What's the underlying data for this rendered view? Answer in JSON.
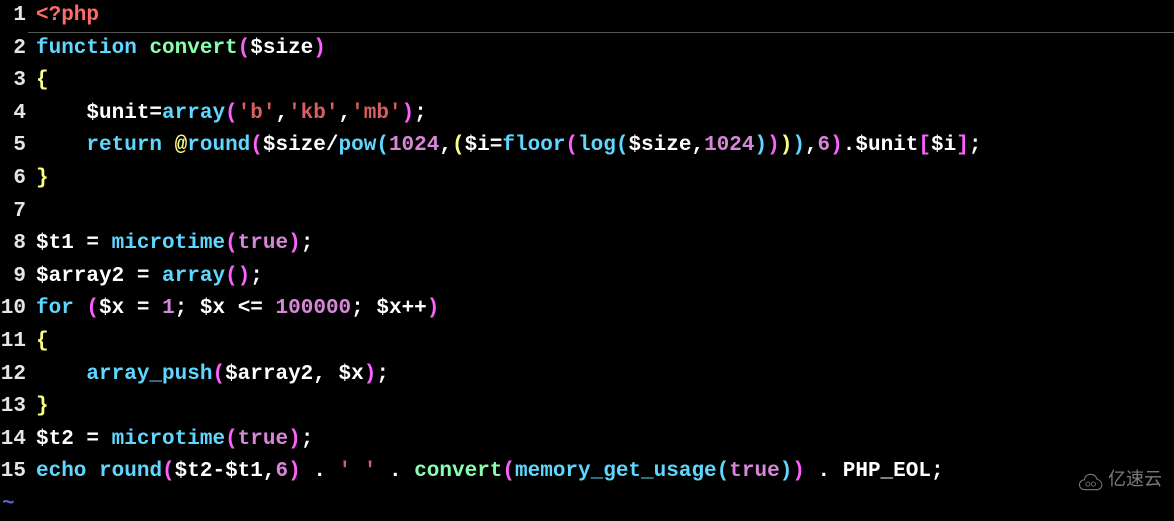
{
  "lines": [
    {
      "num": "1",
      "tokens": [
        [
          "c-tag",
          "<?php"
        ]
      ]
    },
    {
      "num": "2",
      "tokens": [
        [
          "c-keyword",
          "function"
        ],
        [
          "c-var",
          " "
        ],
        [
          "c-funcname",
          "convert"
        ],
        [
          "c-paren",
          "("
        ],
        [
          "c-var",
          "$size"
        ],
        [
          "c-paren",
          ")"
        ]
      ]
    },
    {
      "num": "3",
      "tokens": [
        [
          "c-brace",
          "{"
        ]
      ]
    },
    {
      "num": "4",
      "tokens": [
        [
          "c-var",
          "    $unit"
        ],
        [
          "c-eq",
          "="
        ],
        [
          "c-builtin",
          "array"
        ],
        [
          "c-paren",
          "("
        ],
        [
          "c-string",
          "'b'"
        ],
        [
          "c-var",
          ","
        ],
        [
          "c-string",
          "'kb'"
        ],
        [
          "c-var",
          ","
        ],
        [
          "c-string",
          "'mb'"
        ],
        [
          "c-paren",
          ")"
        ],
        [
          "c-semi",
          ";"
        ]
      ]
    },
    {
      "num": "5",
      "tokens": [
        [
          "c-var",
          "    "
        ],
        [
          "c-keyword",
          "return"
        ],
        [
          "c-var",
          " "
        ],
        [
          "c-at",
          "@"
        ],
        [
          "c-builtin",
          "round"
        ],
        [
          "c-paren",
          "("
        ],
        [
          "c-var",
          "$size"
        ],
        [
          "c-op",
          "/"
        ],
        [
          "c-builtin",
          "pow"
        ],
        [
          "c-paren2",
          "("
        ],
        [
          "c-num",
          "1024"
        ],
        [
          "c-var",
          ","
        ],
        [
          "c-paren3",
          "("
        ],
        [
          "c-var",
          "$i"
        ],
        [
          "c-eq",
          "="
        ],
        [
          "c-builtin",
          "floor"
        ],
        [
          "c-paren4",
          "("
        ],
        [
          "c-builtin",
          "log"
        ],
        [
          "c-paren5",
          "("
        ],
        [
          "c-var",
          "$size"
        ],
        [
          "c-var",
          ","
        ],
        [
          "c-num",
          "1024"
        ],
        [
          "c-paren5",
          ")"
        ],
        [
          "c-paren4",
          ")"
        ],
        [
          "c-paren3",
          ")"
        ],
        [
          "c-paren2",
          ")"
        ],
        [
          "c-var",
          ","
        ],
        [
          "c-num",
          "6"
        ],
        [
          "c-paren",
          ")"
        ],
        [
          "c-dot",
          "."
        ],
        [
          "c-var",
          "$unit"
        ],
        [
          "c-bracket",
          "["
        ],
        [
          "c-var",
          "$i"
        ],
        [
          "c-bracket",
          "]"
        ],
        [
          "c-semi",
          ";"
        ]
      ]
    },
    {
      "num": "6",
      "tokens": [
        [
          "c-brace",
          "}"
        ]
      ]
    },
    {
      "num": "7",
      "tokens": []
    },
    {
      "num": "8",
      "tokens": [
        [
          "c-var",
          "$t1 "
        ],
        [
          "c-eq",
          "="
        ],
        [
          "c-var",
          " "
        ],
        [
          "c-builtin",
          "microtime"
        ],
        [
          "c-paren",
          "("
        ],
        [
          "c-bool",
          "true"
        ],
        [
          "c-paren",
          ")"
        ],
        [
          "c-semi",
          ";"
        ]
      ]
    },
    {
      "num": "9",
      "tokens": [
        [
          "c-var",
          "$array2 "
        ],
        [
          "c-eq",
          "="
        ],
        [
          "c-var",
          " "
        ],
        [
          "c-builtin",
          "array"
        ],
        [
          "c-paren",
          "("
        ],
        [
          "c-paren",
          ")"
        ],
        [
          "c-semi",
          ";"
        ]
      ]
    },
    {
      "num": "10",
      "tokens": [
        [
          "c-keyword",
          "for"
        ],
        [
          "c-var",
          " "
        ],
        [
          "c-paren",
          "("
        ],
        [
          "c-var",
          "$x "
        ],
        [
          "c-eq",
          "="
        ],
        [
          "c-var",
          " "
        ],
        [
          "c-num",
          "1"
        ],
        [
          "c-semi",
          ";"
        ],
        [
          "c-var",
          " $x "
        ],
        [
          "c-op",
          "<="
        ],
        [
          "c-var",
          " "
        ],
        [
          "c-num",
          "100000"
        ],
        [
          "c-semi",
          ";"
        ],
        [
          "c-var",
          " $x"
        ],
        [
          "c-op",
          "++"
        ],
        [
          "c-paren",
          ")"
        ]
      ]
    },
    {
      "num": "11",
      "tokens": [
        [
          "c-brace",
          "{"
        ]
      ]
    },
    {
      "num": "12",
      "tokens": [
        [
          "c-var",
          "    "
        ],
        [
          "c-builtin",
          "array_push"
        ],
        [
          "c-paren",
          "("
        ],
        [
          "c-var",
          "$array2"
        ],
        [
          "c-var",
          ", "
        ],
        [
          "c-var",
          "$x"
        ],
        [
          "c-paren",
          ")"
        ],
        [
          "c-semi",
          ";"
        ]
      ]
    },
    {
      "num": "13",
      "tokens": [
        [
          "c-brace",
          "}"
        ]
      ]
    },
    {
      "num": "14",
      "tokens": [
        [
          "c-var",
          "$t2 "
        ],
        [
          "c-eq",
          "="
        ],
        [
          "c-var",
          " "
        ],
        [
          "c-builtin",
          "microtime"
        ],
        [
          "c-paren",
          "("
        ],
        [
          "c-bool",
          "true"
        ],
        [
          "c-paren",
          ")"
        ],
        [
          "c-semi",
          ";"
        ]
      ]
    },
    {
      "num": "15",
      "tokens": [
        [
          "c-keyword",
          "echo"
        ],
        [
          "c-var",
          " "
        ],
        [
          "c-builtin",
          "round"
        ],
        [
          "c-paren",
          "("
        ],
        [
          "c-var",
          "$t2"
        ],
        [
          "c-op",
          "-"
        ],
        [
          "c-var",
          "$t1"
        ],
        [
          "c-var",
          ","
        ],
        [
          "c-num",
          "6"
        ],
        [
          "c-paren",
          ")"
        ],
        [
          "c-var",
          " "
        ],
        [
          "c-dot",
          "."
        ],
        [
          "c-var",
          " "
        ],
        [
          "c-string",
          "' '"
        ],
        [
          "c-var",
          " "
        ],
        [
          "c-dot",
          "."
        ],
        [
          "c-var",
          " "
        ],
        [
          "c-funcname",
          "convert"
        ],
        [
          "c-paren",
          "("
        ],
        [
          "c-builtin",
          "memory_get_usage"
        ],
        [
          "c-paren2",
          "("
        ],
        [
          "c-bool",
          "true"
        ],
        [
          "c-paren2",
          ")"
        ],
        [
          "c-paren",
          ")"
        ],
        [
          "c-var",
          " "
        ],
        [
          "c-dot",
          "."
        ],
        [
          "c-var",
          " "
        ],
        [
          "c-const",
          "PHP_EOL"
        ],
        [
          "c-semi",
          ";"
        ]
      ]
    }
  ],
  "tilde": "~",
  "watermark": "亿速云"
}
